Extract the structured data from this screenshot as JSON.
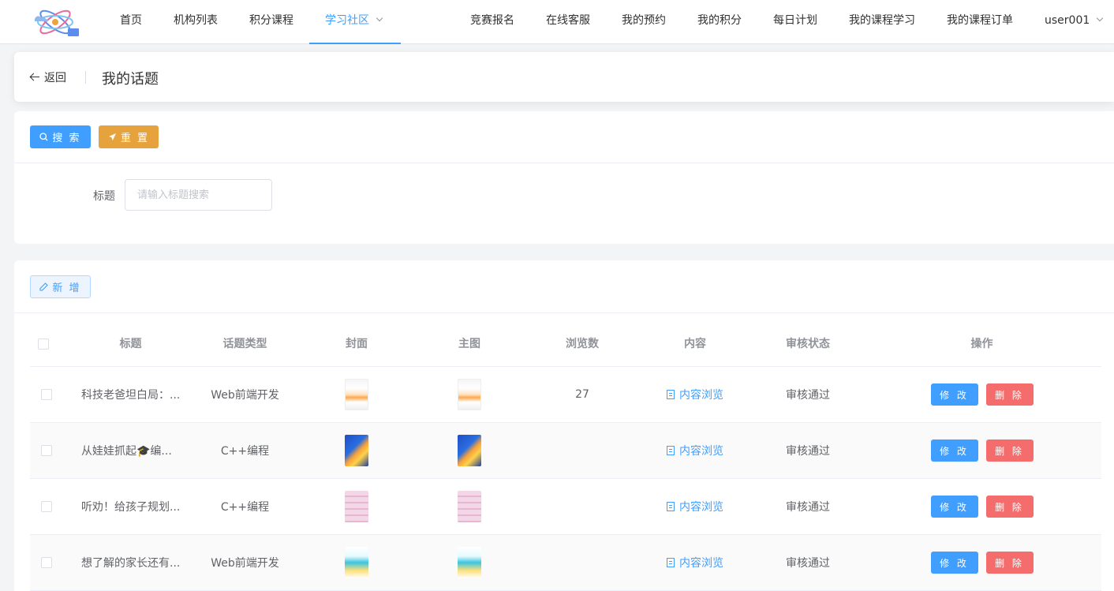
{
  "nav": {
    "left": [
      "首页",
      "机构列表",
      "积分课程"
    ],
    "active": "学习社区",
    "right": [
      "竞赛报名",
      "在线客服",
      "我的预约",
      "我的积分",
      "每日计划",
      "我的课程学习",
      "我的课程订单"
    ],
    "user": "user001"
  },
  "header": {
    "back": "返回",
    "title": "我的话题"
  },
  "filter": {
    "search_label": "搜 索",
    "reset_label": "重 置",
    "field_label": "标题",
    "placeholder": "请输入标题搜索"
  },
  "toolbar": {
    "add_label": "新 增"
  },
  "table": {
    "columns": [
      "标题",
      "话题类型",
      "封面",
      "主图",
      "浏览数",
      "内容",
      "审核状态",
      "操作"
    ],
    "rows": [
      {
        "title": "科技老爸坦白局：...",
        "type": "Web前端开发",
        "views": "27",
        "content": "内容浏览",
        "status": "审核通过",
        "edit": "修 改",
        "delete": "删 除"
      },
      {
        "title": "从娃娃抓起🎓编...",
        "type": "C++编程",
        "views": "",
        "content": "内容浏览",
        "status": "审核通过",
        "edit": "修 改",
        "delete": "删 除"
      },
      {
        "title": "听劝！给孩子规划...",
        "type": "C++编程",
        "views": "",
        "content": "内容浏览",
        "status": "审核通过",
        "edit": "修 改",
        "delete": "删 除"
      },
      {
        "title": "想了解的家长还有...",
        "type": "Web前端开发",
        "views": "",
        "content": "内容浏览",
        "status": "审核通过",
        "edit": "修 改",
        "delete": "删 除"
      }
    ]
  },
  "colors": {
    "primary": "#409eff",
    "warning": "#e6a23c",
    "danger": "#f56c6c"
  }
}
